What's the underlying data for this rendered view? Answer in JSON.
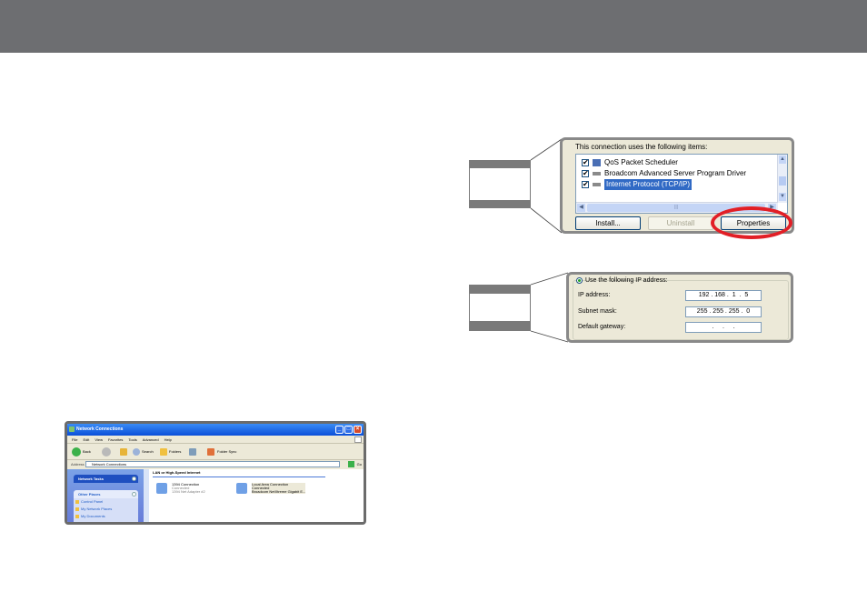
{
  "xp_window": {
    "title": "Network Connections",
    "menu": [
      "File",
      "Edit",
      "View",
      "Favorites",
      "Tools",
      "Advanced",
      "Help"
    ],
    "toolbar": {
      "back": "Back",
      "search": "Search",
      "folders": "Folders",
      "folder_sync": "Folder Sync"
    },
    "address": {
      "label": "Address",
      "value": "Network Connections",
      "go": "Go"
    },
    "network_tasks": "Network Tasks",
    "other_places": "Other Places",
    "other_places_items": [
      "Control Panel",
      "My Network Places",
      "My Documents"
    ],
    "group_header": "LAN or High-Speed Internet",
    "connections": [
      {
        "name": "1394 Connection",
        "status": "Connected",
        "device": "1394 Net Adapter #2"
      },
      {
        "name": "Local Area Connection",
        "status": "Connected",
        "device": "Broadcom NetXtreme Gigabit E..."
      }
    ]
  },
  "properties_dialog": {
    "header": "This connection uses the following items:",
    "items": [
      {
        "label": "QoS Packet Scheduler",
        "checked": true,
        "selected": false
      },
      {
        "label": "Broadcom Advanced Server Program Driver",
        "checked": true,
        "selected": false
      },
      {
        "label": "Internet Protocol (TCP/IP)",
        "checked": true,
        "selected": true
      }
    ],
    "buttons": {
      "install": "Install...",
      "uninstall": "Uninstall",
      "properties": "Properties"
    },
    "highlight_color": "#e21f26"
  },
  "ip_dialog": {
    "radio_label": "Use the following IP address:",
    "fields": [
      {
        "label": "IP address:",
        "value": "192 . 168 .  1  .  5"
      },
      {
        "label": "Subnet mask:",
        "value": "255 . 255 . 255 .  0"
      },
      {
        "label": "Default gateway:",
        "value": "   .     .     .   "
      }
    ]
  },
  "colors": {
    "header_bar": "#6d6e71",
    "selection": "#316ac5",
    "xp_title": "#0a4fd8"
  }
}
